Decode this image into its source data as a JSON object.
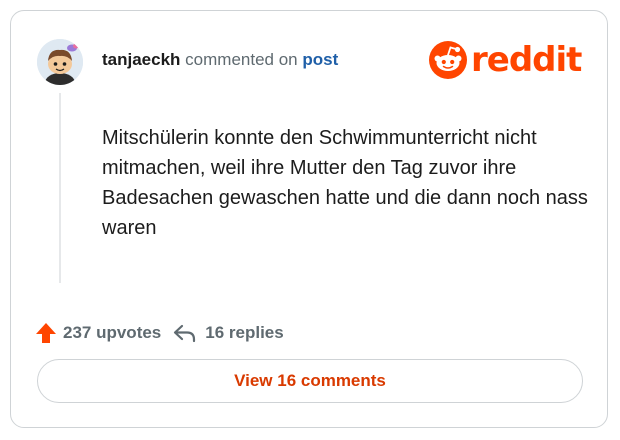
{
  "comment": {
    "username": "tanjaeckh",
    "verb": "commented on",
    "post_link": "post",
    "body": "Mitschülerin konnte den Schwimmunterricht nicht mitmachen, weil ihre Mutter den Tag zuvor ihre Badesachen gewaschen hatte und die dann noch nass waren"
  },
  "brand": {
    "name": "reddit",
    "color": "#ff4500",
    "icon": "reddit-snoo-icon"
  },
  "stats": {
    "upvotes_label": "237 upvotes",
    "upvote_icon": "upvote-arrow-icon",
    "upvote_color": "#ff4500",
    "replies_label": "16 replies",
    "reply_icon": "reply-arrow-icon"
  },
  "actions": {
    "view_comments_label": "View 16 comments"
  }
}
